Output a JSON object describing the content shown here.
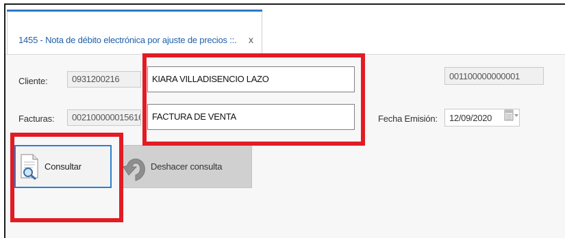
{
  "tab": {
    "title": "1455 - Nota de débito electrónica por ajuste de precios ::.",
    "close": "x"
  },
  "form": {
    "cliente_label": "Cliente:",
    "cliente_id": "0931200216",
    "cliente_name": "KIARA VILLADISENCIO LAZO",
    "doc_number": "001100000000001",
    "facturas_label": "Facturas:",
    "factura_number": "002100000015616",
    "factura_type": "FACTURA DE VENTA",
    "fecha_label": "Fecha Emisión:",
    "fecha_value": "12/09/2020"
  },
  "buttons": {
    "consultar": "Consultar",
    "deshacer": "Deshacer consulta"
  },
  "icons": {
    "consultar": "document-search-icon",
    "deshacer": "undo-arrow-icon",
    "calendar": "calendar-icon",
    "dropdown": "chevron-down-icon"
  },
  "colors": {
    "tab_title": "#1f5fa8",
    "highlight": "#e31b23",
    "active_border": "#2a7fd0"
  }
}
